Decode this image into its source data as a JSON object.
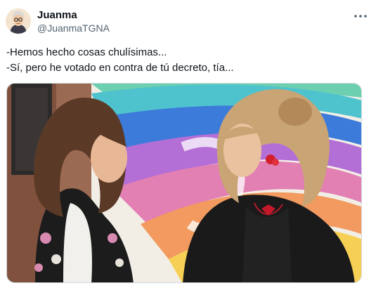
{
  "tweet": {
    "author": {
      "display_name": "Juanma",
      "handle": "@JuanmaTGNA",
      "avatar_icon": "cartoon-portrait-avatar"
    },
    "more_icon": "more-horizontal-icon",
    "text_lines": [
      "-Hemos hecho cosas chulísimas...",
      "-Sí, pero he votado en contra de tú decreto, tía..."
    ],
    "media": {
      "type": "photo",
      "image_icon": "photo-two-women-rainbow-background"
    },
    "colors": {
      "text": "#0f1419",
      "secondary_text": "#536471",
      "border": "#cfd9de"
    }
  }
}
